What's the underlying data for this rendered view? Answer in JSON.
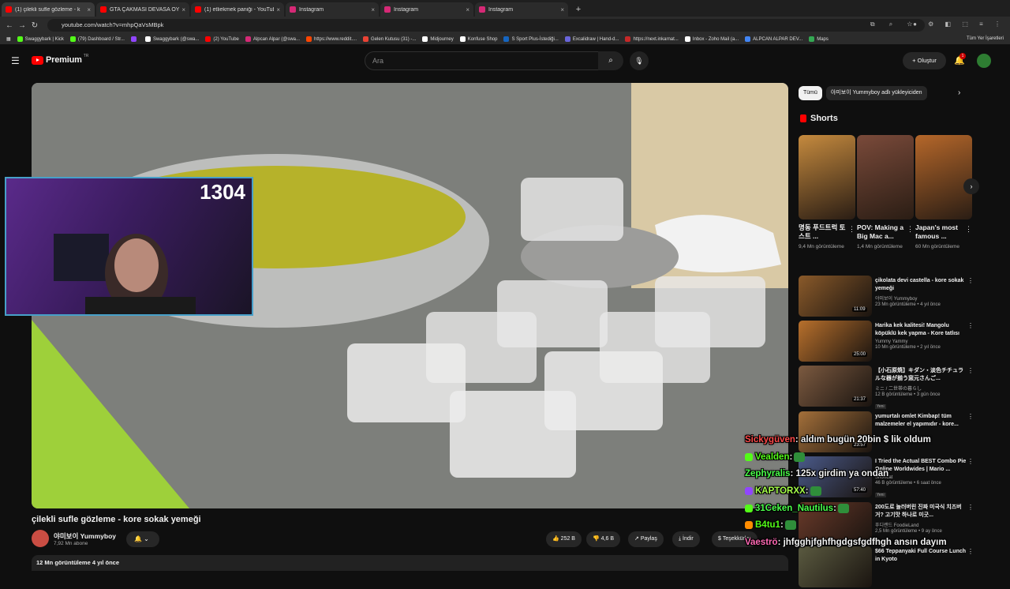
{
  "browser": {
    "tabs": [
      {
        "title": "(1) çilekli sufle gözleme - k",
        "color": "#ff0000",
        "active": true
      },
      {
        "title": "GTA ÇAKMASI DEVASA OYUNU",
        "color": "#ff0000"
      },
      {
        "title": "(1) etliekmek paniği - YouTube",
        "color": "#ff0000"
      },
      {
        "title": "Instagram",
        "color": "#d62976"
      },
      {
        "title": "Instagram",
        "color": "#d62976"
      },
      {
        "title": "Instagram",
        "color": "#d62976"
      }
    ],
    "url": "youtube.com/watch?v=mhpQaVsMBpk",
    "bookmarks": [
      {
        "label": "Swaggybark | Kick",
        "color": "#53fc18"
      },
      {
        "label": "(79) Dashboard / Str...",
        "color": "#53fc18"
      },
      {
        "label": "",
        "color": "#9146ff"
      },
      {
        "label": "Swaggybark (@swa...",
        "color": "#ffffff"
      },
      {
        "label": "(2) YouTube",
        "color": "#ff0000"
      },
      {
        "label": "Alpcan Alpar (@swa...",
        "color": "#d62976"
      },
      {
        "label": "https://www.reddit....",
        "color": "#ff4500"
      },
      {
        "label": "Gelen Kutusu (31) -...",
        "color": "#ea4335"
      },
      {
        "label": "Midjourney",
        "color": "#ffffff"
      },
      {
        "label": "Konfuse Shop",
        "color": "#ffffff"
      },
      {
        "label": "S Sport Plus-İstediği...",
        "color": "#1565c0"
      },
      {
        "label": "Excalidraw | Hand-d...",
        "color": "#6965db"
      },
      {
        "label": "https://next.inkarnat...",
        "color": "#c62828"
      },
      {
        "label": "Inbox - Zoho Mail (a...",
        "color": "#ffffff"
      },
      {
        "label": "ALPCAN ALPAR DEV...",
        "color": "#4285f4"
      },
      {
        "label": "Maps",
        "color": "#34a853"
      }
    ],
    "all_bookmarks": "Tüm Yer İşaretleri"
  },
  "youtube": {
    "logo": "Premium",
    "region": "TR",
    "search_placeholder": "Ara",
    "create": "Oluştur",
    "notif_count": "1",
    "video": {
      "title": "çilekli sufle gözleme - kore sokak yemeği",
      "channel": "야미보이 Yummyboy",
      "subscribers": "7,92 Mn abone",
      "likes": "252 B",
      "dislikes": "4,6 B",
      "share": "Paylaş",
      "download": "İndir",
      "thanks": "Teşekkürler",
      "views_line": "12 Mn görüntüleme  4 yıl önce"
    },
    "chips": [
      "Tümü",
      "야미보이 Yummyboy adlı yükleyiciden"
    ],
    "shorts_title": "Shorts",
    "shorts": [
      {
        "title": "명동 푸드트럭 토스트 ...",
        "views": "9,4 Mn görüntüleme",
        "color": "#c58a3e"
      },
      {
        "title": "POV: Making a Big Mac a...",
        "views": "1,4 Mn görüntüleme",
        "color": "#7a4a3a"
      },
      {
        "title": "Japan's most famous ...",
        "views": "60 Mn görüntüleme",
        "color": "#b5672a"
      }
    ],
    "videos": [
      {
        "title": "çikolata devi castella - kore sokak yemeği",
        "channel": "야미보이 Yummyboy",
        "meta": "23 Mn görüntüleme • 4 yıl önce",
        "duration": "11:09",
        "new": "",
        "color": "#8a5a2a"
      },
      {
        "title": "Harika kek kalitesi! Mangolu köpüklü kek yapma - Kore tatlısı",
        "channel": "Yummy Yammy",
        "meta": "10 Mn görüntüleme • 2 yıl önce",
        "duration": "25:00",
        "new": "",
        "color": "#b8702c"
      },
      {
        "title": "【小石原焼】キダン・淡色チチュラルな器が揃う窯元さんご...",
        "channel": "ミニ / 二世帯の暮らし",
        "meta": "12 B görüntüleme • 3 gün önce",
        "duration": "21:37",
        "new": "Yeni",
        "color": "#7c5a40"
      },
      {
        "title": "yumurtalı omlet Kimbap! tüm malzemeler el yapımıdır - kore...",
        "channel": "",
        "meta": "",
        "duration": "23:57",
        "new": "",
        "color": "#a4703a"
      },
      {
        "title": "I Tried the Actual BEST Combo Pie Online Worldwides | Mario ...",
        "channel": "Shortcat",
        "meta": "46 B görüntüleme • 6 saat önce",
        "duration": "57:40",
        "new": "Yeni",
        "color": "#4a5a8a"
      },
      {
        "title": "200도로 놀러버린 진짜 미국식 치즈버거? 고기맛 하나로 미굿...",
        "channel": "푸디랜드 FoodieLand",
        "meta": "2,5 Mn görüntüleme • 9 ay önce",
        "duration": "",
        "new": "",
        "color": "#6a3a2a"
      },
      {
        "title": "$66 Teppanyaki Full Course Lunch in Kyoto",
        "channel": "",
        "meta": "",
        "duration": "",
        "new": "",
        "color": "#5a5a40"
      }
    ]
  },
  "overlay": {
    "viewer_count": "1304",
    "chat": [
      {
        "user": "Sickygüven",
        "msg": ": aldım bugün 20bin $ lik oldum",
        "color": "#ff4a4a",
        "badge": ""
      },
      {
        "user": "Vealden",
        "msg": ":",
        "color": "#53fc18",
        "badge": "#53fc18",
        "emote": true
      },
      {
        "user": "Zephyralis",
        "msg": ": 125x girdim ya ondan",
        "color": "#4aff4a",
        "badge": ""
      },
      {
        "user": "KAPTORXX",
        "msg": ":",
        "color": "#a6ff4a",
        "badge": "#9146ff",
        "emote": true
      },
      {
        "user": "31Ceken_Nautilus",
        "msg": ":",
        "color": "#4aff4a",
        "badge": "#53fc18",
        "emote": true
      },
      {
        "user": "B4tu1",
        "msg": ":",
        "color": "#53fc18",
        "badge": "#ff8c00",
        "emote": true
      },
      {
        "user": "Vaeströ",
        "msg": ": jhfgghjfghfhgdgsfgdfhgh ansın dayım",
        "color": "#ff69b4",
        "badge": ""
      }
    ]
  }
}
